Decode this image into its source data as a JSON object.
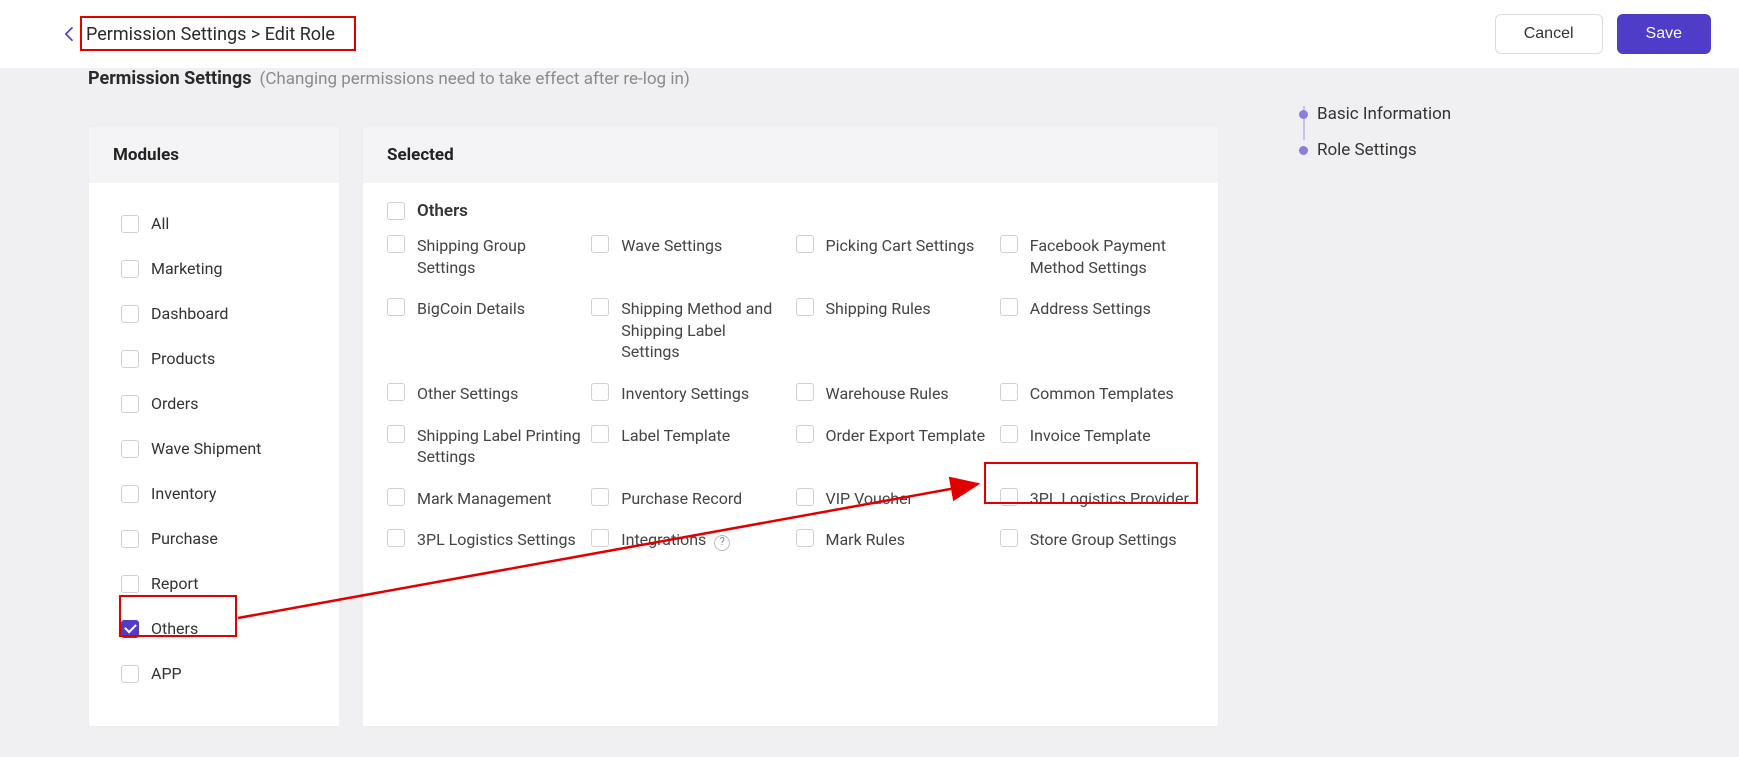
{
  "header": {
    "breadcrumb": "Permission Settings > Edit Role",
    "cancel": "Cancel",
    "save": "Save"
  },
  "section": {
    "title": "Permission Settings",
    "subtitle": "(Changing permissions need to take effect after re-log in)"
  },
  "panels": {
    "modules_header": "Modules",
    "selected_header": "Selected"
  },
  "modules": [
    {
      "label": "All",
      "checked": false
    },
    {
      "label": "Marketing",
      "checked": false
    },
    {
      "label": "Dashboard",
      "checked": false
    },
    {
      "label": "Products",
      "checked": false
    },
    {
      "label": "Orders",
      "checked": false
    },
    {
      "label": "Wave Shipment",
      "checked": false
    },
    {
      "label": "Inventory",
      "checked": false
    },
    {
      "label": "Purchase",
      "checked": false
    },
    {
      "label": "Report",
      "checked": false
    },
    {
      "label": "Others",
      "checked": true
    },
    {
      "label": "APP",
      "checked": false
    }
  ],
  "selected_group": {
    "title": "Others",
    "items": [
      {
        "label": "Shipping Group Settings"
      },
      {
        "label": "Wave Settings"
      },
      {
        "label": "Picking Cart Settings"
      },
      {
        "label": "Facebook Payment Method Settings"
      },
      {
        "label": "BigCoin Details"
      },
      {
        "label": "Shipping Method and Shipping Label Settings"
      },
      {
        "label": "Shipping Rules"
      },
      {
        "label": "Address Settings"
      },
      {
        "label": "Other Settings"
      },
      {
        "label": "Inventory Settings"
      },
      {
        "label": "Warehouse Rules"
      },
      {
        "label": "Common Templates"
      },
      {
        "label": "Shipping Label Printing Settings"
      },
      {
        "label": "Label Template"
      },
      {
        "label": "Order Export Template"
      },
      {
        "label": "Invoice Template"
      },
      {
        "label": "Mark Management"
      },
      {
        "label": "Purchase Record"
      },
      {
        "label": "VIP Voucher"
      },
      {
        "label": "3PL Logistics Provider"
      },
      {
        "label": "3PL Logistics Settings"
      },
      {
        "label": "Integrations",
        "help": true
      },
      {
        "label": "Mark Rules"
      },
      {
        "label": "Store Group Settings"
      }
    ]
  },
  "anchors": [
    {
      "label": "Basic Information"
    },
    {
      "label": "Role Settings"
    }
  ]
}
